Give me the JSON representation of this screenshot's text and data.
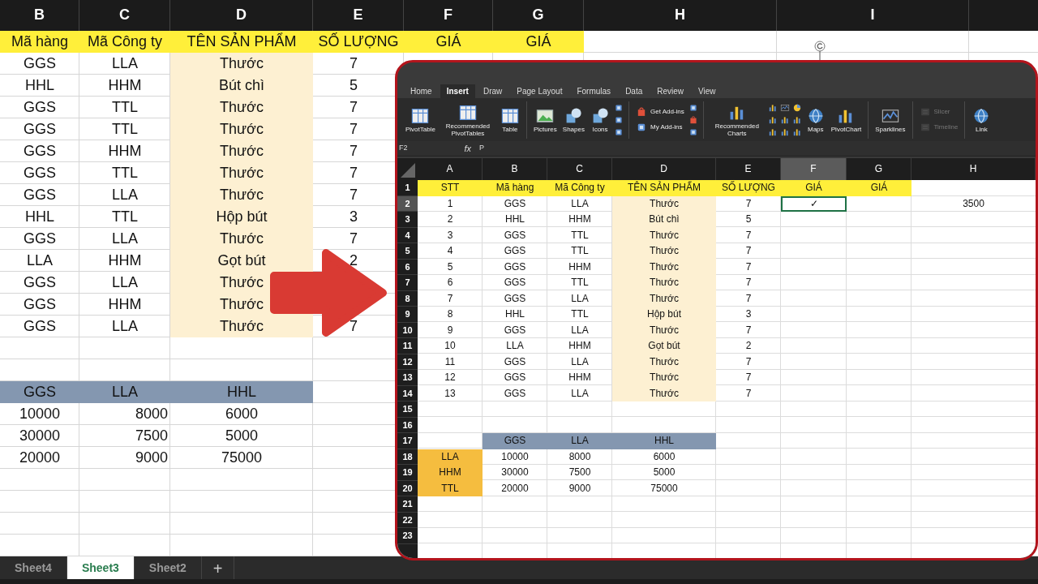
{
  "outer_sheet": {
    "column_headers": [
      "B",
      "C",
      "D",
      "E",
      "F",
      "G",
      "H",
      "I"
    ],
    "header_row": [
      "Mã hàng",
      "Mã Công ty",
      "TÊN SẢN PHẨM",
      "SỐ LƯỢNG",
      "GIÁ",
      "GIÁ"
    ],
    "rows": [
      {
        "ma_hang": "GGS",
        "ma_cong_ty": "LLA",
        "ten_san_pham": "Thước",
        "so_luong": "7"
      },
      {
        "ma_hang": "HHL",
        "ma_cong_ty": "HHM",
        "ten_san_pham": "Bút chì",
        "so_luong": "5"
      },
      {
        "ma_hang": "GGS",
        "ma_cong_ty": "TTL",
        "ten_san_pham": "Thước",
        "so_luong": "7"
      },
      {
        "ma_hang": "GGS",
        "ma_cong_ty": "TTL",
        "ten_san_pham": "Thước",
        "so_luong": "7"
      },
      {
        "ma_hang": "GGS",
        "ma_cong_ty": "HHM",
        "ten_san_pham": "Thước",
        "so_luong": "7"
      },
      {
        "ma_hang": "GGS",
        "ma_cong_ty": "TTL",
        "ten_san_pham": "Thước",
        "so_luong": "7"
      },
      {
        "ma_hang": "GGS",
        "ma_cong_ty": "LLA",
        "ten_san_pham": "Thước",
        "so_luong": "7"
      },
      {
        "ma_hang": "HHL",
        "ma_cong_ty": "TTL",
        "ten_san_pham": "Hộp bút",
        "so_luong": "3"
      },
      {
        "ma_hang": "GGS",
        "ma_cong_ty": "LLA",
        "ten_san_pham": "Thước",
        "so_luong": "7"
      },
      {
        "ma_hang": "LLA",
        "ma_cong_ty": "HHM",
        "ten_san_pham": "Gọt bút",
        "so_luong": "2"
      },
      {
        "ma_hang": "GGS",
        "ma_cong_ty": "LLA",
        "ten_san_pham": "Thước"
      },
      {
        "ma_hang": "GGS",
        "ma_cong_ty": "HHM",
        "ten_san_pham": "Thước"
      },
      {
        "ma_hang": "GGS",
        "ma_cong_ty": "LLA",
        "ten_san_pham": "Thước",
        "so_luong": "7"
      }
    ],
    "price_table": {
      "columns": [
        "GGS",
        "LLA",
        "HHL"
      ],
      "rows": [
        [
          "10000",
          "8000",
          "6000"
        ],
        [
          "30000",
          "7500",
          "5000"
        ],
        [
          "20000",
          "9000",
          "75000"
        ]
      ]
    }
  },
  "sheet_tabs": [
    {
      "label": "Sheet4",
      "selected": false
    },
    {
      "label": "Sheet3",
      "selected": true
    },
    {
      "label": "Sheet2",
      "selected": false
    }
  ],
  "add_sheet_button": "+",
  "inset": {
    "ribbon_tabs": [
      {
        "label": "Home",
        "selected": false
      },
      {
        "label": "Insert",
        "selected": true
      },
      {
        "label": "Draw",
        "selected": false
      },
      {
        "label": "Page Layout",
        "selected": false
      },
      {
        "label": "Formulas",
        "selected": false
      },
      {
        "label": "Data",
        "selected": false
      },
      {
        "label": "Review",
        "selected": false
      },
      {
        "label": "View",
        "selected": false
      }
    ],
    "ribbon_groups": [
      [
        {
          "kind": "large",
          "label": "PivotTable",
          "disabled": false
        },
        {
          "kind": "large",
          "label": "Recommended PivotTables",
          "disabled": false
        },
        {
          "kind": "large",
          "label": "Table",
          "disabled": false
        }
      ],
      [
        {
          "kind": "large",
          "label": "Pictures",
          "disabled": false
        },
        {
          "kind": "large",
          "label": "Shapes",
          "disabled": false
        },
        {
          "kind": "large",
          "label": "Icons",
          "disabled": false
        },
        {
          "kind": "icon",
          "disabled": false
        },
        {
          "kind": "icon",
          "disabled": false
        },
        {
          "kind": "icon",
          "disabled": false
        }
      ],
      [
        {
          "kind": "small",
          "label": "Get Add-ins",
          "disabled": false
        },
        {
          "kind": "small",
          "label": "My Add-ins",
          "disabled": false
        },
        {
          "kind": "icon",
          "disabled": false
        },
        {
          "kind": "icon",
          "disabled": false
        },
        {
          "kind": "icon",
          "disabled": false
        }
      ],
      [
        {
          "kind": "large",
          "label": "Recommended Charts",
          "disabled": false
        },
        {
          "kind": "icon",
          "disabled": false
        },
        {
          "kind": "icon",
          "disabled": false
        },
        {
          "kind": "icon",
          "disabled": false
        },
        {
          "kind": "icon",
          "disabled": false
        },
        {
          "kind": "icon",
          "disabled": false
        },
        {
          "kind": "icon",
          "disabled": false
        },
        {
          "kind": "icon",
          "disabled": false
        },
        {
          "kind": "icon",
          "disabled": false
        },
        {
          "kind": "icon",
          "disabled": false
        },
        {
          "kind": "large",
          "label": "Maps",
          "disabled": false
        },
        {
          "kind": "large",
          "label": "PivotChart",
          "disabled": false
        }
      ],
      [
        {
          "kind": "large",
          "label": "Sparklines",
          "disabled": false
        }
      ],
      [
        {
          "kind": "small",
          "label": "Slicer",
          "disabled": true
        },
        {
          "kind": "small",
          "label": "Timeline",
          "disabled": true
        }
      ],
      [
        {
          "kind": "large",
          "label": "Link",
          "disabled": false
        }
      ]
    ],
    "formula_bar": {
      "cell_ref": "F2",
      "fx": "fx",
      "value": "P"
    },
    "column_headers": [
      {
        "label": "A",
        "selected": false
      },
      {
        "label": "B",
        "selected": false
      },
      {
        "label": "C",
        "selected": false
      },
      {
        "label": "D",
        "selected": false
      },
      {
        "label": "E",
        "selected": false
      },
      {
        "label": "F",
        "selected": true
      },
      {
        "label": "G",
        "selected": false
      },
      {
        "label": "H",
        "selected": false
      }
    ],
    "row_numbers": [
      {
        "label": "1",
        "selected": false
      },
      {
        "label": "2",
        "selected": true
      },
      {
        "label": "3",
        "selected": false
      },
      {
        "label": "4",
        "selected": false
      },
      {
        "label": "5",
        "selected": false
      },
      {
        "label": "6",
        "selected": false
      },
      {
        "label": "7",
        "selected": false
      },
      {
        "label": "8",
        "selected": false
      },
      {
        "label": "9",
        "selected": false
      },
      {
        "label": "10",
        "selected": false
      },
      {
        "label": "11",
        "selected": false
      },
      {
        "label": "12",
        "selected": false
      },
      {
        "label": "13",
        "selected": false
      },
      {
        "label": "14",
        "selected": false
      },
      {
        "label": "15",
        "selected": false
      },
      {
        "label": "16",
        "selected": false
      },
      {
        "label": "17",
        "selected": false
      },
      {
        "label": "18",
        "selected": false
      },
      {
        "label": "19",
        "selected": false
      },
      {
        "label": "20",
        "selected": false
      },
      {
        "label": "21",
        "selected": false
      },
      {
        "label": "22",
        "selected": false
      },
      {
        "label": "23",
        "selected": false
      }
    ],
    "header_row": [
      "STT",
      "Mã hàng",
      "Mã Công ty",
      "TÊN SẢN PHẨM",
      "SỐ LƯỢNG",
      "GIÁ",
      "GIÁ"
    ],
    "rows": [
      {
        "stt": "1",
        "ma_hang": "GGS",
        "ma_cong_ty": "LLA",
        "ten_san_pham": "Thước",
        "so_luong": "7",
        "gia": "✓",
        "column_h": "3500"
      },
      {
        "stt": "2",
        "ma_hang": "HHL",
        "ma_cong_ty": "HHM",
        "ten_san_pham": "Bút chì",
        "so_luong": "5"
      },
      {
        "stt": "3",
        "ma_hang": "GGS",
        "ma_cong_ty": "TTL",
        "ten_san_pham": "Thước",
        "so_luong": "7"
      },
      {
        "stt": "4",
        "ma_hang": "GGS",
        "ma_cong_ty": "TTL",
        "ten_san_pham": "Thước",
        "so_luong": "7"
      },
      {
        "stt": "5",
        "ma_hang": "GGS",
        "ma_cong_ty": "HHM",
        "ten_san_pham": "Thước",
        "so_luong": "7"
      },
      {
        "stt": "6",
        "ma_hang": "GGS",
        "ma_cong_ty": "TTL",
        "ten_san_pham": "Thước",
        "so_luong": "7"
      },
      {
        "stt": "7",
        "ma_hang": "GGS",
        "ma_cong_ty": "LLA",
        "ten_san_pham": "Thước",
        "so_luong": "7"
      },
      {
        "stt": "8",
        "ma_hang": "HHL",
        "ma_cong_ty": "TTL",
        "ten_san_pham": "Hộp bút",
        "so_luong": "3"
      },
      {
        "stt": "9",
        "ma_hang": "GGS",
        "ma_cong_ty": "LLA",
        "ten_san_pham": "Thước",
        "so_luong": "7"
      },
      {
        "stt": "10",
        "ma_hang": "LLA",
        "ma_cong_ty": "HHM",
        "ten_san_pham": "Gọt bút",
        "so_luong": "2"
      },
      {
        "stt": "11",
        "ma_hang": "GGS",
        "ma_cong_ty": "LLA",
        "ten_san_pham": "Thước",
        "so_luong": "7"
      },
      {
        "stt": "12",
        "ma_hang": "GGS",
        "ma_cong_ty": "HHM",
        "ten_san_pham": "Thước",
        "so_luong": "7"
      },
      {
        "stt": "13",
        "ma_hang": "GGS",
        "ma_cong_ty": "LLA",
        "ten_san_pham": "Thước",
        "so_luong": "7"
      }
    ],
    "price_table": {
      "columns": [
        "GGS",
        "LLA",
        "HHL"
      ],
      "row_labels": [
        "LLA",
        "HHM",
        "TTL"
      ],
      "rows": [
        [
          "10000",
          "8000",
          "6000"
        ],
        [
          "30000",
          "7500",
          "5000"
        ],
        [
          "20000",
          "9000",
          "75000"
        ]
      ]
    }
  }
}
